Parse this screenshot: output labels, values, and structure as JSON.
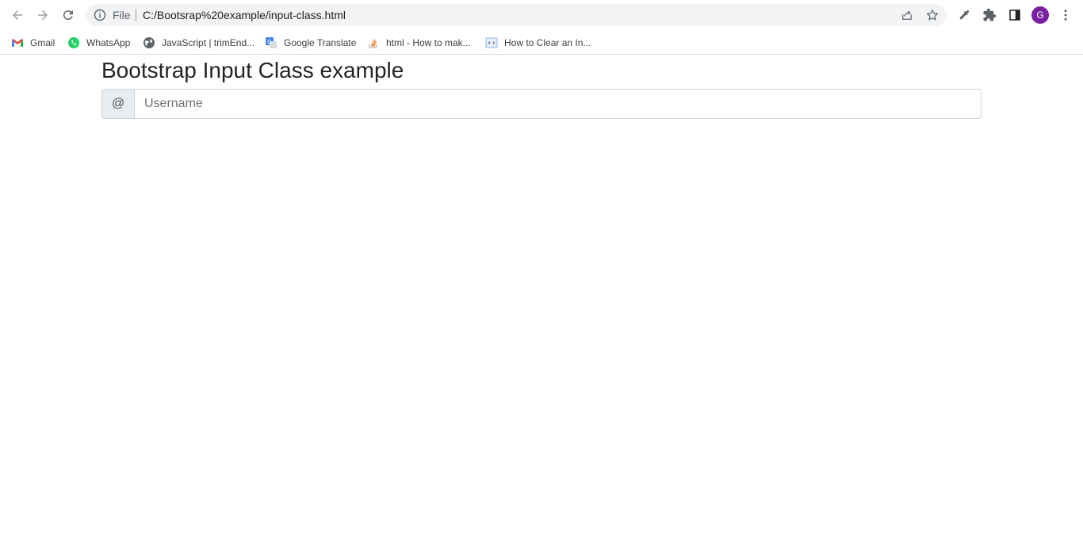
{
  "browser": {
    "url_scheme": "File",
    "url": "C:/Bootsrap%20example/input-class.html",
    "profile_initial": "G",
    "accent": "#7b1fa2"
  },
  "bookmarks": [
    {
      "label": "Gmail",
      "icon": "gmail-icon"
    },
    {
      "label": "WhatsApp",
      "icon": "whatsapp-icon"
    },
    {
      "label": "JavaScript | trimEnd...",
      "icon": "globe-icon"
    },
    {
      "label": "Google Translate",
      "icon": "google-translate-icon"
    },
    {
      "label": "html - How to mak...",
      "icon": "stackoverflow-icon"
    },
    {
      "label": "How to Clear an In...",
      "icon": "code-page-icon"
    }
  ],
  "page": {
    "title": "Bootstrap Input Class example",
    "input_group": {
      "addon": "@",
      "placeholder": "Username",
      "value": ""
    }
  }
}
